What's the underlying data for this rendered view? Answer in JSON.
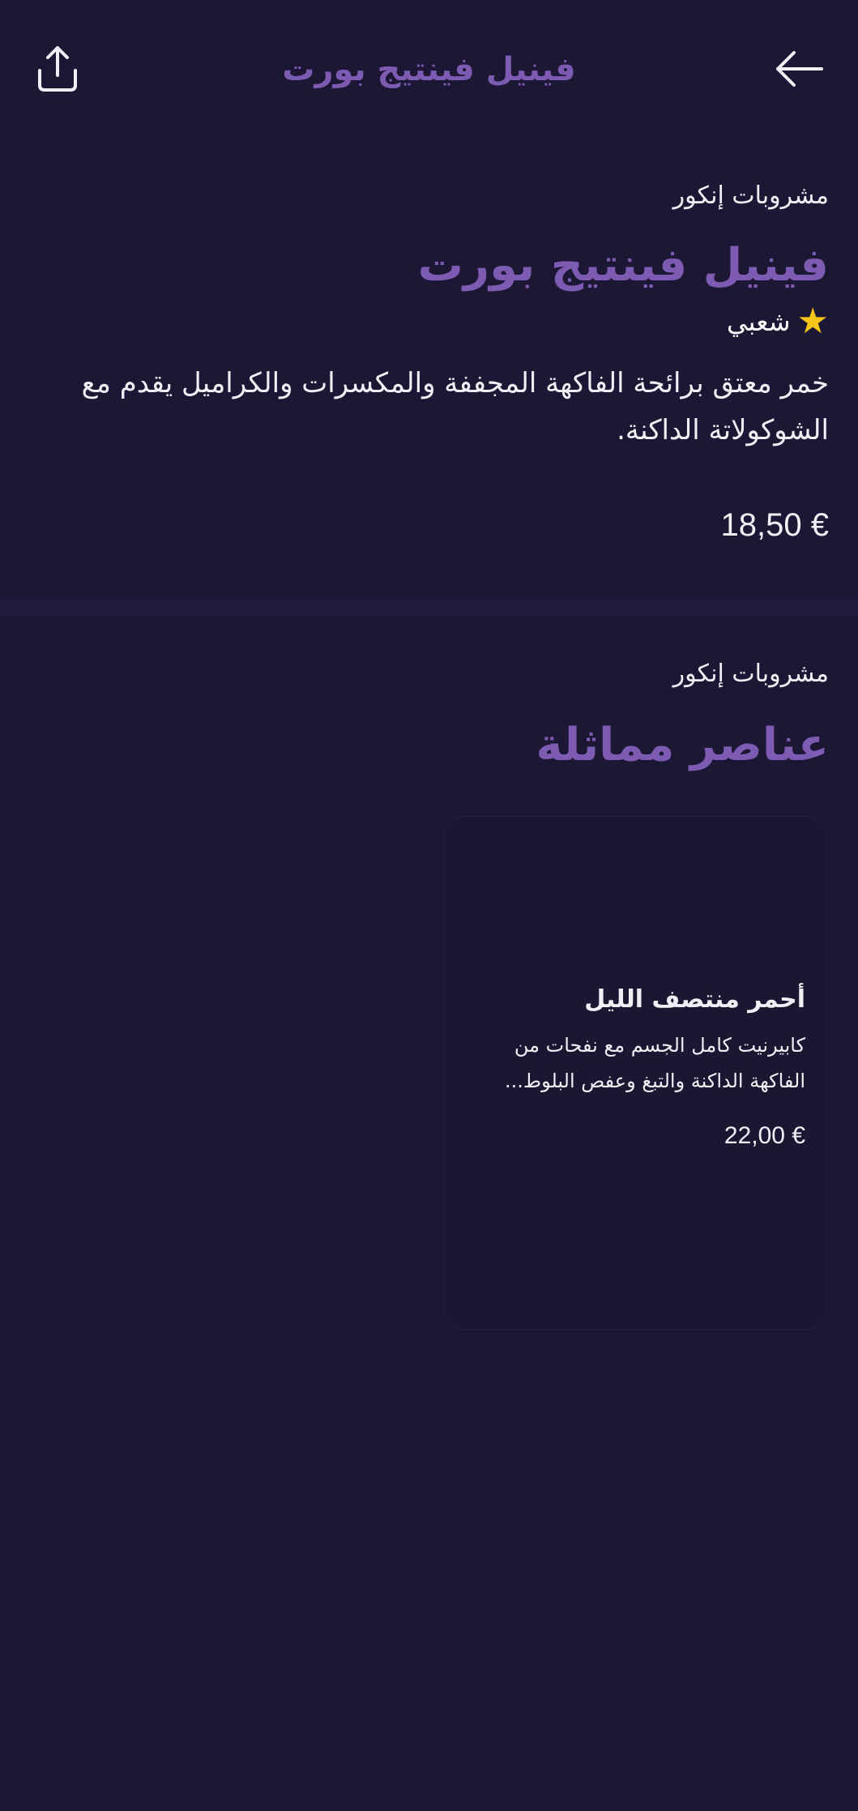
{
  "header": {
    "title": "فينيل فينتيج بورت",
    "share_icon": "share-icon",
    "back_icon": "arrow-right-icon"
  },
  "product": {
    "category": "مشروبات إنكور",
    "name": "فينيل فينتيج بورت",
    "badge": "شعبي",
    "badge_icon": "star-icon",
    "description": "خمر معتق برائحة الفاكهة المجففة والمكسرات والكراميل يقدم مع الشوكولاتة الداكنة.",
    "price": "18,50 €"
  },
  "similar": {
    "category": "مشروبات إنكور",
    "title": "عناصر مماثلة",
    "items": [
      {
        "name": "أحمر منتصف الليل",
        "description": "كابيرنيت كامل الجسم مع نفحات من الفاكهة الداكنة والتبغ وعفص البلوط...",
        "price": "22,00 €"
      }
    ]
  },
  "colors": {
    "background": "#1c1734",
    "accent": "#7d5bb3",
    "star": "#f5c518",
    "text": "#f1eff6"
  }
}
